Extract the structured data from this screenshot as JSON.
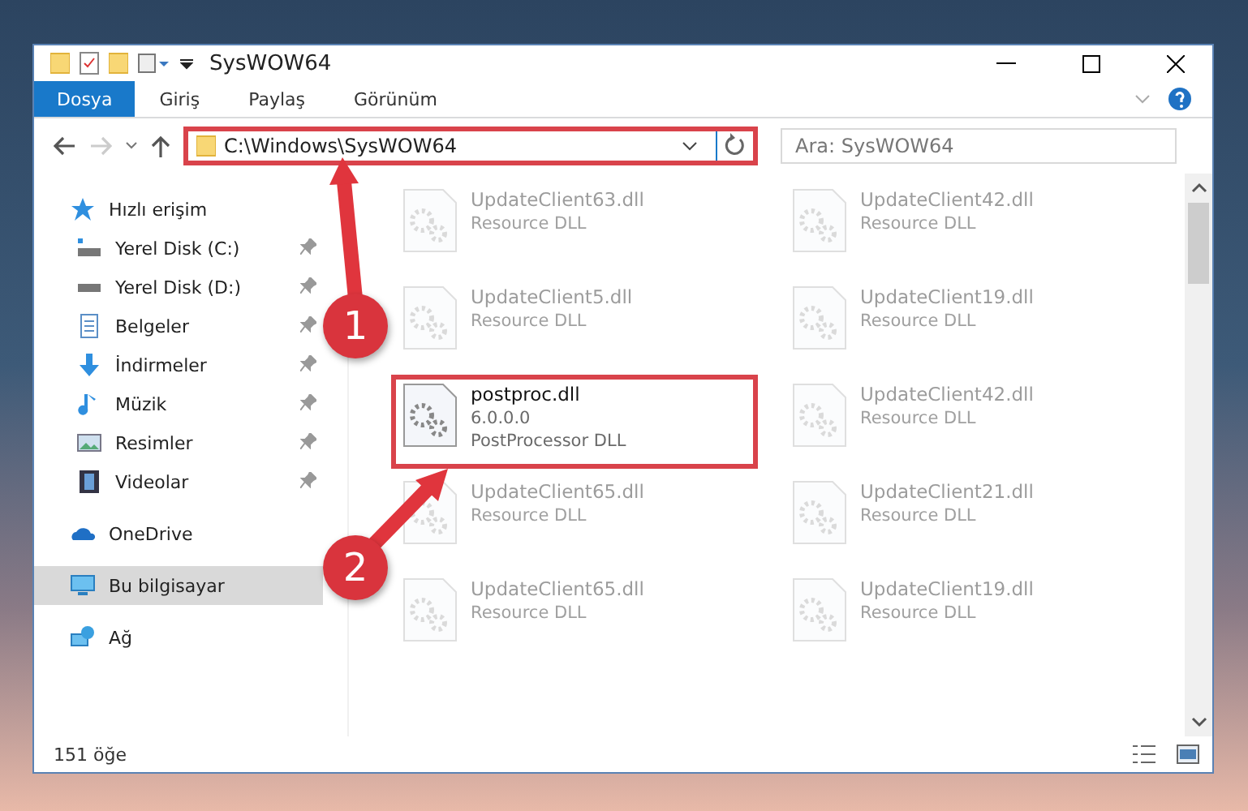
{
  "window": {
    "title": "SysWOW64"
  },
  "ribbon_tabs": [
    {
      "label": "Dosya",
      "kind": "file"
    },
    {
      "label": "Giriş",
      "kind": "tab"
    },
    {
      "label": "Paylaş",
      "kind": "tab"
    },
    {
      "label": "Görünüm",
      "kind": "tab"
    }
  ],
  "address": {
    "value": "C:\\Windows\\SysWOW64",
    "highlighted": true
  },
  "search": {
    "placeholder": "Ara: SysWOW64"
  },
  "sidebar": {
    "items": [
      {
        "label": "Hızlı erişim",
        "kind": "star",
        "selected": false,
        "children": [
          {
            "label": "Yerel Disk (C:)",
            "kind": "drive-c",
            "pinned": true,
            "selected": false
          },
          {
            "label": "Yerel Disk (D:)",
            "kind": "drive",
            "pinned": true,
            "selected": false
          },
          {
            "label": "Belgeler",
            "kind": "document",
            "pinned": true,
            "selected": false
          },
          {
            "label": "İndirmeler",
            "kind": "download",
            "pinned": true,
            "selected": false
          },
          {
            "label": "Müzik",
            "kind": "music",
            "pinned": true,
            "selected": false
          },
          {
            "label": "Resimler",
            "kind": "picture",
            "pinned": true,
            "selected": false
          },
          {
            "label": "Videolar",
            "kind": "video",
            "pinned": true,
            "selected": false
          }
        ]
      },
      {
        "label": "OneDrive",
        "kind": "cloud",
        "selected": false
      },
      {
        "label": "Bu bilgisayar",
        "kind": "computer",
        "selected": true
      },
      {
        "label": "Ağ",
        "kind": "network",
        "selected": false
      }
    ]
  },
  "files": [
    {
      "name": "UpdateClient63.dll",
      "lines": [
        "Resource DLL"
      ],
      "faded": true,
      "highlighted": false
    },
    {
      "name": "UpdateClient42.dll",
      "lines": [
        "Resource DLL"
      ],
      "faded": true,
      "highlighted": false
    },
    {
      "name": "UpdateClient5.dll",
      "lines": [
        "Resource DLL"
      ],
      "faded": true,
      "highlighted": false
    },
    {
      "name": "UpdateClient19.dll",
      "lines": [
        "Resource DLL"
      ],
      "faded": true,
      "highlighted": false
    },
    {
      "name": "postproc.dll",
      "lines": [
        "6.0.0.0",
        "PostProcessor DLL"
      ],
      "faded": false,
      "highlighted": true
    },
    {
      "name": "UpdateClient42.dll",
      "lines": [
        "Resource DLL"
      ],
      "faded": true,
      "highlighted": false
    },
    {
      "name": "UpdateClient65.dll",
      "lines": [
        "Resource DLL"
      ],
      "faded": true,
      "highlighted": false
    },
    {
      "name": "UpdateClient21.dll",
      "lines": [
        "Resource DLL"
      ],
      "faded": true,
      "highlighted": false
    },
    {
      "name": "UpdateClient65.dll",
      "lines": [
        "Resource DLL"
      ],
      "faded": true,
      "highlighted": false
    },
    {
      "name": "UpdateClient19.dll",
      "lines": [
        "Resource DLL"
      ],
      "faded": true,
      "highlighted": false
    }
  ],
  "callouts": [
    {
      "number": "1"
    },
    {
      "number": "2"
    }
  ],
  "status_bar": {
    "count": "151 öğe"
  }
}
